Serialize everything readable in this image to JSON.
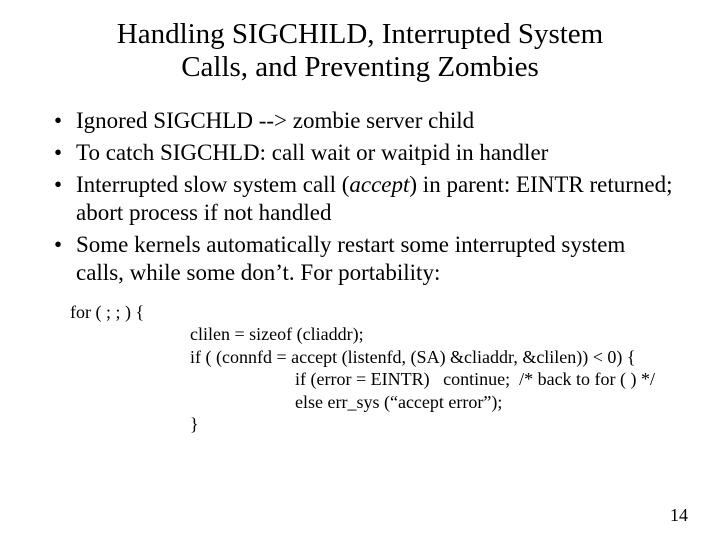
{
  "title_l1": "Handling SIGCHILD, Interrupted System",
  "title_l2": "Calls, and Preventing Zombies",
  "bullets": {
    "b1": "Ignored SIGCHLD --> zombie server child",
    "b2": "To catch SIGCHLD: call wait or waitpid in handler",
    "b3a": "Interrupted slow system call (",
    "b3_italic": "accept",
    "b3b": ") in parent: EINTR returned; abort process if not handled",
    "b4": "Some kernels automatically restart some interrupted system calls, while some don’t. For portability:"
  },
  "code": {
    "l1": "for ( ; ; ) {",
    "l2": "clilen = sizeof (cliaddr);",
    "l3": "if ( (connfd = accept (listenfd, (SA) &cliaddr, &clilen)) < 0) {",
    "l4": "if (error = EINTR)   continue;  /* back to for ( ) */",
    "l5": "else err_sys (“accept error”);",
    "l6": "}"
  },
  "page_number": "14"
}
